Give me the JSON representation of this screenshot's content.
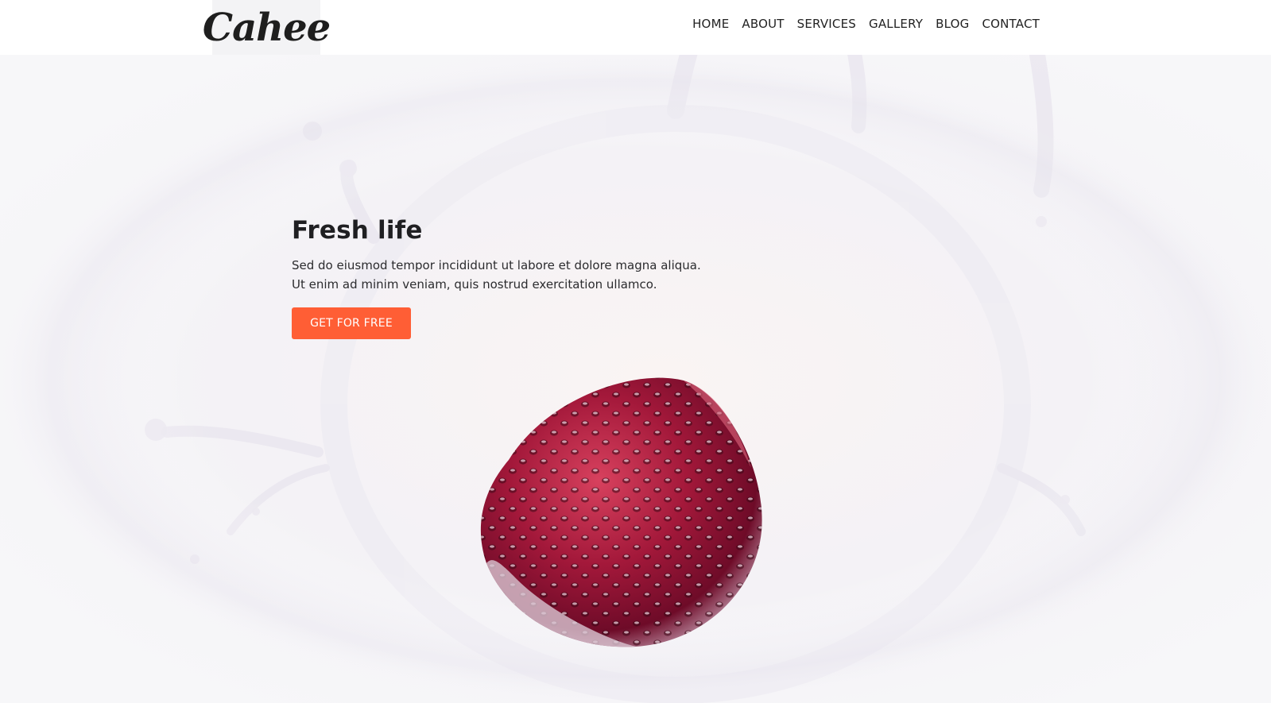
{
  "header": {
    "logo_text": "Cahee",
    "nav": [
      {
        "label": "HOME"
      },
      {
        "label": "ABOUT"
      },
      {
        "label": "SERVICES"
      },
      {
        "label": "GALLERY"
      },
      {
        "label": "BLOG"
      },
      {
        "label": "CONTACT"
      }
    ]
  },
  "hero": {
    "title": "Fresh life",
    "text_line_1": "Sed do eiusmod tempor incididunt ut labore et dolore magna aliqua.",
    "text_line_2": "Ut enim ad minim veniam, quis nostrud exercitation ullamco.",
    "cta_label": "GET FOR FREE"
  },
  "colors": {
    "accent": "#ff5e35",
    "header_bg": "#ffffff",
    "logo_bg": "#f3f3f5",
    "hero_bg": "#f6f5f8"
  }
}
